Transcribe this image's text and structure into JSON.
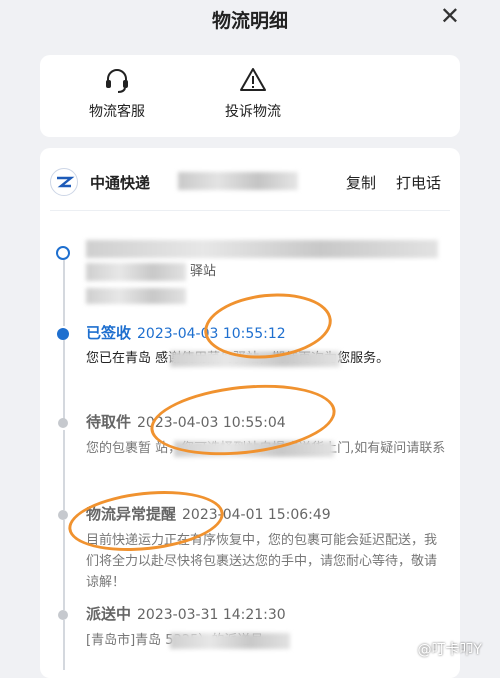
{
  "header": {
    "title": "物流明细",
    "close_glyph": "✕"
  },
  "actions": [
    {
      "label": "物流客服",
      "icon": "headset-icon"
    },
    {
      "label": "投诉物流",
      "icon": "warning-icon"
    }
  ],
  "carrier": {
    "name": "中通快递",
    "copy_label": "复制",
    "call_label": "打电话"
  },
  "events": [
    {
      "status": "",
      "time": "",
      "desc": "驿站"
    },
    {
      "status": "已签收",
      "time": "2023-04-03 10:55:12",
      "desc": "您已在青岛 感谢使用菜鸟驿站，期待再次为您服务。"
    },
    {
      "status": "待取件",
      "time": "2023-04-03 10:55:04",
      "desc": "您的包裹暂 站，您可选择到站自提或送货上门,如有疑问请联系"
    },
    {
      "status": "物流异常提醒",
      "time": "2023-04-01 15:06:49",
      "desc": "目前快递运力正在有序恢复中，您的包裹可能会延迟配送，我们将全力以赴尽快将包裹送达您的手中，请您耐心等待，敬请谅解！"
    },
    {
      "status": "派送中",
      "time": "2023-03-31 14:21:30",
      "desc": "[青岛市]青岛 5325）的派送员"
    }
  ],
  "watermark": "@叮卡叩Y",
  "colors": {
    "accent": "#1e6fcf",
    "highlight": "#f0922f",
    "muted": "#8a8a8a"
  }
}
